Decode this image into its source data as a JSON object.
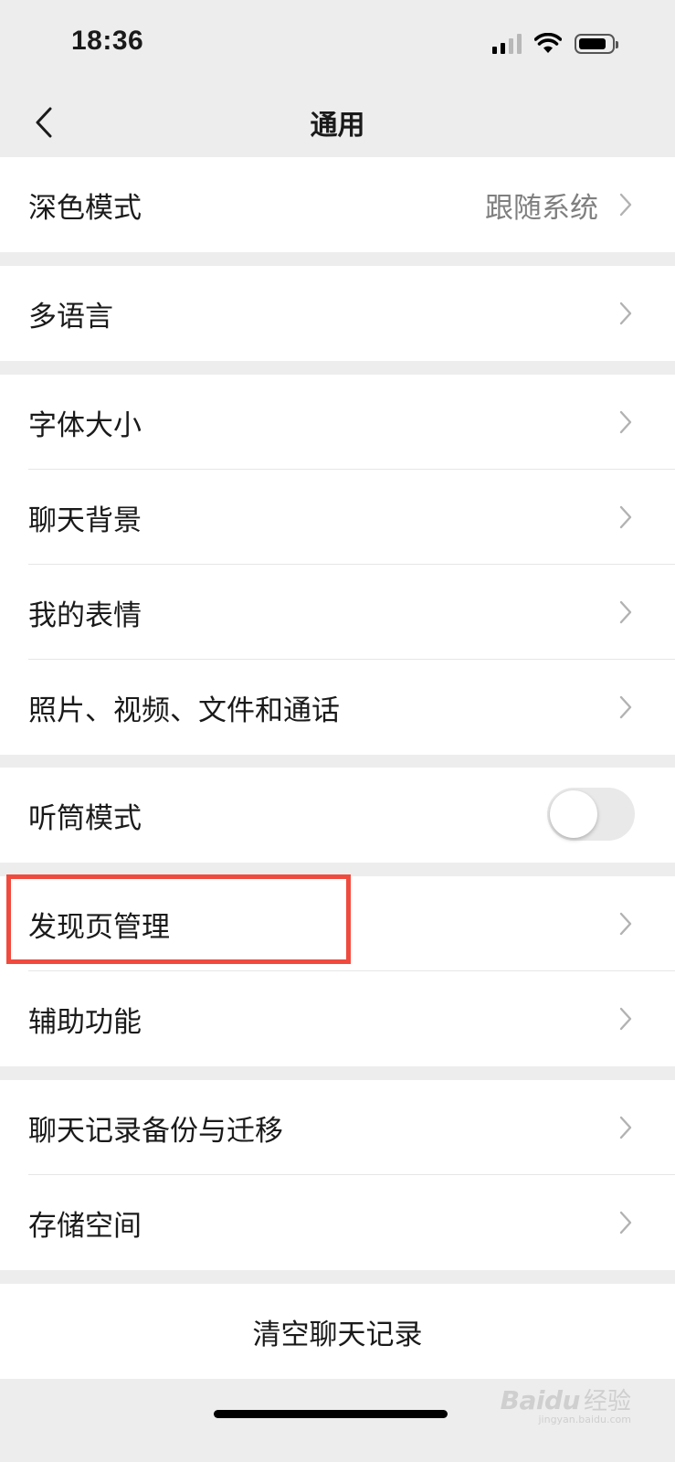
{
  "status_bar": {
    "time": "18:36",
    "icons": [
      "signal-icon",
      "wifi-icon",
      "battery-icon"
    ]
  },
  "nav": {
    "title": "通用",
    "back_icon": "chevron-left-icon"
  },
  "sections": [
    {
      "items": [
        {
          "label": "深色模式",
          "value": "跟随系统"
        }
      ]
    },
    {
      "items": [
        {
          "label": "多语言"
        }
      ]
    },
    {
      "items": [
        {
          "label": "字体大小"
        },
        {
          "label": "聊天背景"
        },
        {
          "label": "我的表情"
        },
        {
          "label": "照片、视频、文件和通话"
        }
      ]
    },
    {
      "items": [
        {
          "label": "听筒模式",
          "toggle": false
        }
      ]
    },
    {
      "items": [
        {
          "label": "发现页管理",
          "highlighted": true
        },
        {
          "label": "辅助功能"
        }
      ]
    },
    {
      "items": [
        {
          "label": "聊天记录备份与迁移"
        },
        {
          "label": "存储空间"
        }
      ]
    }
  ],
  "clear_button": {
    "label": "清空聊天记录"
  },
  "colors": {
    "background": "#ededed",
    "highlight": "#f04a3e",
    "secondary_text": "#7f7f7f"
  },
  "watermark": {
    "brand": "Baidu",
    "suffix": "经验",
    "url": "jingyan.baidu.com"
  }
}
